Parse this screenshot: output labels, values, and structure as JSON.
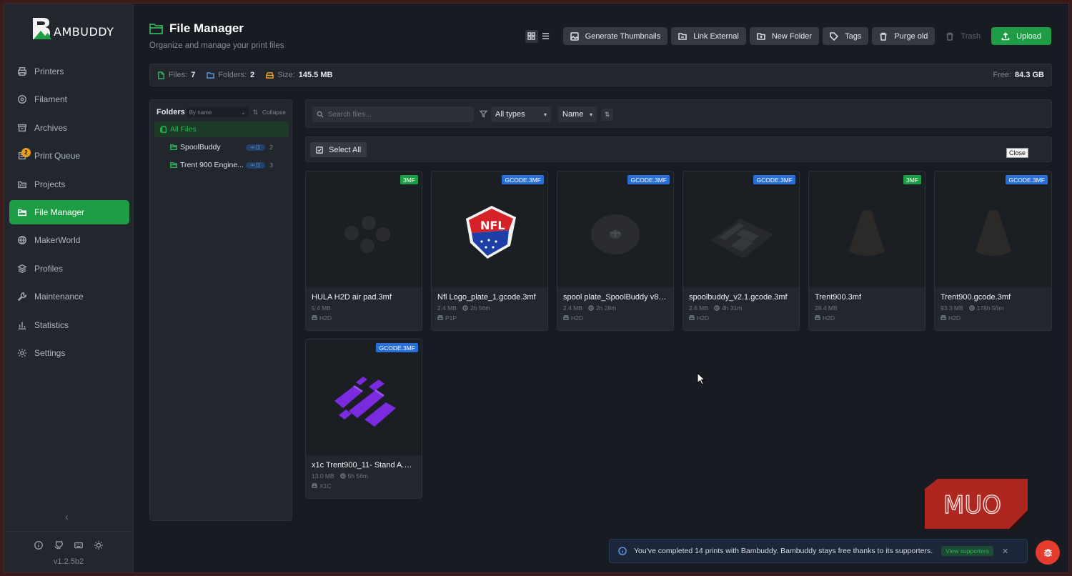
{
  "app": {
    "logo_text": "AMBUDDY",
    "version": "v1.2.5b2"
  },
  "sidebar": {
    "items": [
      {
        "label": "Printers",
        "icon": "printer-icon"
      },
      {
        "label": "Filament",
        "icon": "spool-icon"
      },
      {
        "label": "Archives",
        "icon": "archive-icon"
      },
      {
        "label": "Print Queue",
        "icon": "queue-icon",
        "badge": "2"
      },
      {
        "label": "Projects",
        "icon": "folder-kanban-icon"
      },
      {
        "label": "File Manager",
        "icon": "folder-open-icon",
        "active": true
      },
      {
        "label": "MakerWorld",
        "icon": "globe-icon"
      },
      {
        "label": "Profiles",
        "icon": "layers-icon"
      },
      {
        "label": "Maintenance",
        "icon": "wrench-icon"
      },
      {
        "label": "Statistics",
        "icon": "bar-chart-icon"
      },
      {
        "label": "Settings",
        "icon": "gear-icon"
      }
    ]
  },
  "header": {
    "title": "File Manager",
    "subtitle": "Organize and manage your print files",
    "buttons": {
      "generate": "Generate Thumbnails",
      "link": "Link External",
      "new_folder": "New Folder",
      "tags": "Tags",
      "purge": "Purge old",
      "trash": "Trash",
      "upload": "Upload"
    }
  },
  "stats": {
    "files_label": "Files:",
    "files": "7",
    "folders_label": "Folders:",
    "folders": "2",
    "size_label": "Size:",
    "size": "145.5 MB",
    "free_label": "Free:",
    "free": "84.3 GB"
  },
  "folders": {
    "title": "Folders",
    "sort": "By name",
    "collapse": "Collapse",
    "all": "All Files",
    "items": [
      {
        "name": "SpoolBuddy",
        "count": "2"
      },
      {
        "name": "Trent 900 Engine...",
        "count": "3"
      }
    ]
  },
  "filters": {
    "search_placeholder": "Search files...",
    "type": "All types",
    "sort": "Name"
  },
  "select_all": "Select All",
  "tooltip": "Close",
  "files": [
    {
      "name": "HULA H2D air pad.3mf",
      "size": "5.4 MB",
      "time": "",
      "printer": "H2D",
      "type": "3MF"
    },
    {
      "name": "Nfl Logo_plate_1.gcode.3mf",
      "size": "2.4 MB",
      "time": "2h 56m",
      "printer": "P1P",
      "type": "GCODE.3MF"
    },
    {
      "name": "spool plate_SpoolBuddy v86_...",
      "size": "2.4 MB",
      "time": "2h 28m",
      "printer": "H2D",
      "type": "GCODE.3MF"
    },
    {
      "name": "spoolbuddy_v2.1.gcode.3mf",
      "size": "2.6 MB",
      "time": "4h 31m",
      "printer": "H2D",
      "type": "GCODE.3MF"
    },
    {
      "name": "Trent900.3mf",
      "size": "28.4 MB",
      "time": "",
      "printer": "H2D",
      "type": "3MF"
    },
    {
      "name": "Trent900.gcode.3mf",
      "size": "93.3 MB",
      "time": "178h 56m",
      "printer": "H2D",
      "type": "GCODE.3MF"
    },
    {
      "name": "x1c Trent900_11- Stand A.gc...",
      "size": "13.0 MB",
      "time": "5h 56m",
      "printer": "X1C",
      "type": "GCODE.3MF"
    }
  ],
  "notification": {
    "text": "You've completed 14 prints with Bambuddy. Bambuddy stays free thanks to its supporters.",
    "action": "View supporters"
  },
  "watermark": "MUO",
  "colors": {
    "accent": "#1f9c46",
    "badge_blue": "#2a6fd8",
    "badge_green": "#1d9c46",
    "bug": "#e53a2e"
  }
}
